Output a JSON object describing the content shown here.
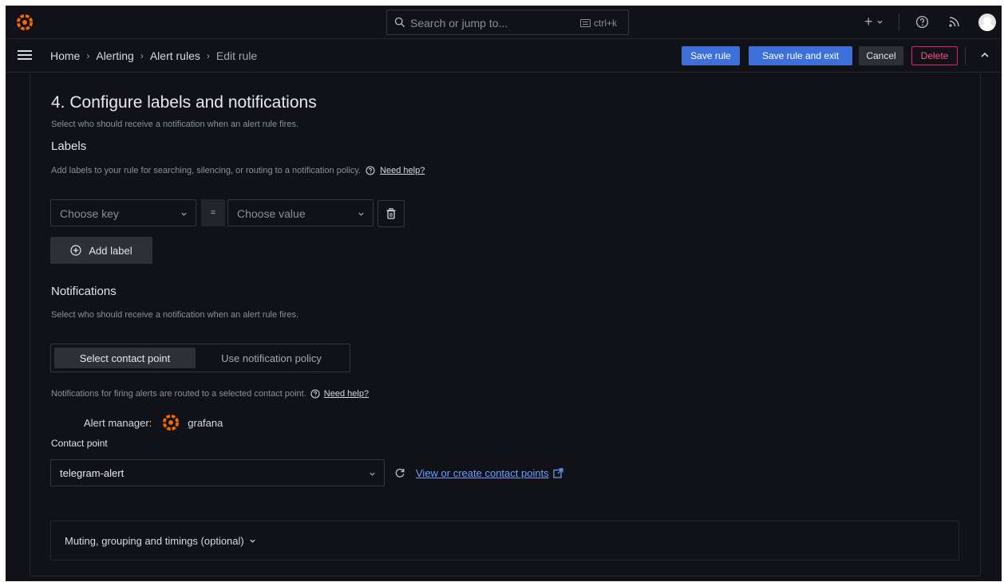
{
  "topbar": {
    "search_placeholder": "Search or jump to...",
    "search_shortcut": "ctrl+k",
    "new_button_label": "+",
    "brand_color": "#f46800"
  },
  "navbar": {
    "breadcrumb": [
      "Home",
      "Alerting",
      "Alert rules",
      "Edit rule"
    ],
    "save_rule": "Save rule",
    "save_rule_exit": "Save rule and exit",
    "cancel": "Cancel",
    "delete": "Delete"
  },
  "section": {
    "title": "4. Configure labels and notifications",
    "subtitle": "Select who should receive a notification when an alert rule fires."
  },
  "labels": {
    "heading": "Labels",
    "description": "Add labels to your rule for searching, silencing, or routing to a notification policy.",
    "need_help": "Need help?",
    "key_placeholder": "Choose key",
    "operator": "=",
    "value_placeholder": "Choose value",
    "add_label": "Add label"
  },
  "notifications": {
    "heading": "Notifications",
    "description": "Select who should receive a notification when an alert rule fires.",
    "options": [
      "Select contact point",
      "Use notification policy"
    ],
    "selected_option": "Select contact point",
    "routed_text": "Notifications for firing alerts are routed to a selected contact point.",
    "need_help": "Need help?",
    "alert_manager_label": "Alert manager:",
    "alert_manager_value": "grafana",
    "contact_point_label": "Contact point",
    "contact_point_value": "telegram-alert",
    "view_create_link": "View or create contact points"
  },
  "muting": {
    "title": "Muting, grouping and timings (optional)"
  }
}
